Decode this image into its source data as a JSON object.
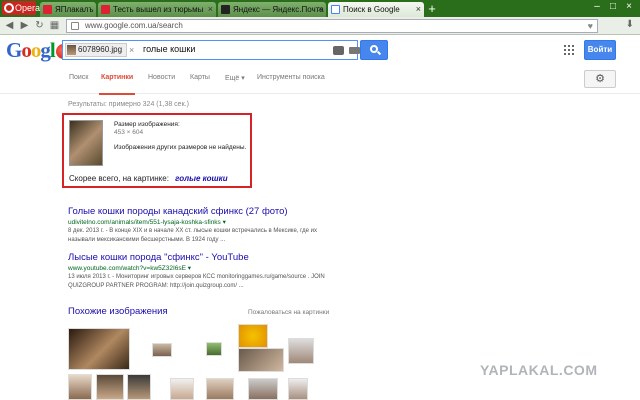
{
  "browser": {
    "menu_label": "Opera",
    "tabs": [
      {
        "title": "ЯПлакалъ",
        "active": false
      },
      {
        "title": "Тесть вышел из тюрьмы",
        "active": false
      },
      {
        "title": "Яндекс — Яндекс.Почта",
        "active": false
      },
      {
        "title": "Поиск в Google",
        "active": true
      }
    ],
    "url": "www.google.com.ua/search",
    "window_controls": [
      "–",
      "□",
      "×"
    ]
  },
  "search": {
    "image_chip": "6078960.jpg",
    "query": "голые кошки",
    "login_label": "Войти"
  },
  "nav_tabs": [
    "Поиск",
    "Картинки",
    "Новости",
    "Карты",
    "Ещё ▾",
    "Инструменты поиска"
  ],
  "active_tab": "Картинки",
  "stats": "Результаты: примерно 324 (1,38 сек.)",
  "image_card": {
    "size_label": "Размер изображения:",
    "size_value": "453 × 604",
    "other_sizes": "Изображения других размеров не найдены.",
    "best_guess_label": "Скорее всего, на картинке:",
    "best_guess_link": "голые кошки"
  },
  "results": [
    {
      "title": "Голые кошки породы канадский сфинкс (27 фото)",
      "cite": "udivitelno.com/animals/item/551-lysaja-koshka-sfinks ▾",
      "snippet": "8 дек. 2013 г. - В конце XIX и в начале XX ст. лысые кошки встречались в Мексике, где их называли мексиканскими бесшерстными. В 1924 году ..."
    },
    {
      "title": "Лысые кошки порода \"сфинкс\" - YouTube",
      "cite": "www.youtube.com/watch?v=kw5Z32I6sE ▾",
      "snippet": "13 июля 2013 г. - Мониторинг игровых серверов КСС monitoringgames.ru/game/source . JOIN QUIZGROUP PARTNER PROGRAM: http://join.quizgroup.com/ ..."
    }
  ],
  "similar": {
    "heading": "Похожие изображения",
    "report": "Пожаловаться на картинки"
  },
  "watermark": "YAPLAKAL.COM"
}
